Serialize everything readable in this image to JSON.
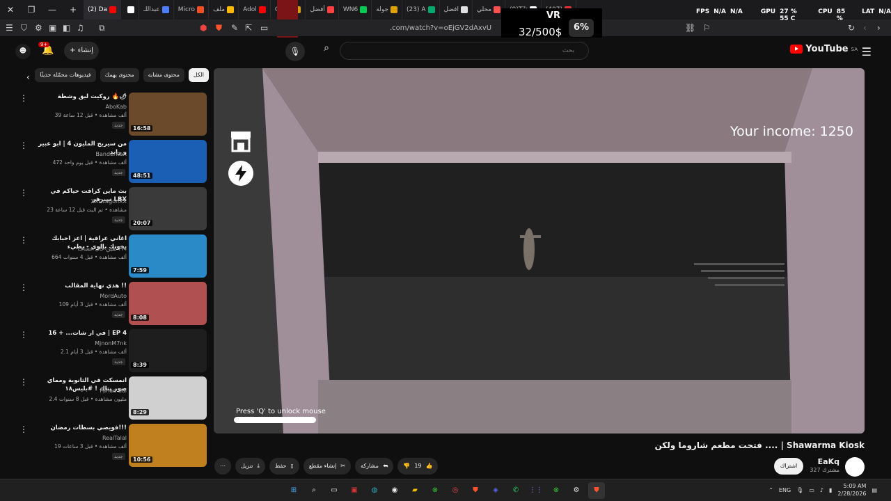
{
  "browser": {
    "tabs": [
      {
        "label": "(2) Da",
        "color": "#ff0000",
        "active": true
      },
      {
        "label": "",
        "color": "#ffffff"
      },
      {
        "label": "عبداللـ",
        "color": "#4c7dff"
      },
      {
        "label": "Micro",
        "color": "#f25022"
      },
      {
        "label": "ملف",
        "color": "#ffb900"
      },
      {
        "label": "Adol",
        "color": "#ff0000"
      },
      {
        "label": "Chick",
        "color": "#d4a017"
      },
      {
        "label": "أفضل",
        "color": "#ff4040"
      },
      {
        "label": "WN6",
        "color": "#00c853"
      },
      {
        "label": "جولة",
        "color": "#e0a000"
      },
      {
        "label": "(23) A",
        "color": "#00a86b"
      },
      {
        "label": "افضل",
        "color": "#e0e0e0"
      },
      {
        "label": "محلي",
        "color": "#ff5050"
      },
      {
        "label": "(9)Tik",
        "color": "#ffffff"
      },
      {
        "label": "(407)",
        "color": "#e03030"
      }
    ],
    "url": ".com/watch?v=oEjGV2dAxvU"
  },
  "overlay": {
    "vr_label": "VR",
    "money": "32/500$",
    "percent": "6%",
    "hw": {
      "fps_label": "FPS",
      "fps_value": "N/A",
      "na2": "N/A",
      "gpu_label": "GPU",
      "gpu_value": "27 % 55 C",
      "cpu_label": "CPU",
      "cpu_value": "85 %",
      "lat_label": "LAT",
      "lat_value": "N/A"
    }
  },
  "youtube": {
    "logo_text": "YouTube",
    "logo_region": "SA",
    "search_placeholder": "بحث",
    "create_label": "إنشاء",
    "notif_count": "9+"
  },
  "chips": [
    "الكل",
    "محتوى مشابه",
    "محتوى يهمك",
    "فيديوهات محمّلة حديثًا"
  ],
  "recommendations": [
    {
      "title": "روكيت ليق وشطة 🔥🌶",
      "channel": "AboKab",
      "meta": "39 ألف مشاهدة • قبل 12 ساعة",
      "badge": "جديد",
      "duration": "16:58",
      "thumb": "#6a4a2a"
    },
    {
      "title": "من سيربح المليون 4 | ابو عبير و رايد",
      "channel": "BanderitaX",
      "meta": "472 ألف مشاهدة • قبل يوم واحد",
      "badge": "جديد",
      "duration": "48:51",
      "thumb": "#1a5fb4"
    },
    {
      "title": "بث ماين كرافت حياكم في سيرفر LBX",
      "channel": "XXDragonXX",
      "meta": "23 مشاهدة • تم البث قبل 12 ساعة",
      "badge": "جديد",
      "duration": "20:07",
      "thumb": "#3a3a3a"
    },
    {
      "title": "اغاني عراقية | اعز احبابك بخونك بالوي - بطيء",
      "channel": "لمين حال عشاف FM",
      "meta": "664 ألف مشاهدة • قبل 4 سنوات",
      "badge": "",
      "duration": "7:59",
      "thumb": "#2a8ac8"
    },
    {
      "title": "هذي نهاية المقالب !!",
      "channel": "MordAuto",
      "meta": "109 ألف مشاهدة • قبل 3 أيام",
      "badge": "جديد",
      "duration": "8:08",
      "thumb": "#b05050"
    },
    {
      "title": "في ار شات... + 16 | EP 4",
      "channel": "MjnonM7nk",
      "meta": "2.1 ألف مشاهدة • قبل 3 أيام",
      "badge": "جديد",
      "duration": "8:39",
      "thumb": "#1e1e1e"
    },
    {
      "title": "انمسكت في الثانوية ومماي صور بتاك ! #بليس١٨",
      "channel": "Fahad Sal",
      "meta": "2.4 مليون مشاهدة • قبل 8 سنوات",
      "badge": "",
      "duration": "8:29",
      "thumb": "#d0d0d0"
    },
    {
      "title": "فويصي بسطات رمضان!!!",
      "channel": "RealTalal",
      "meta": "19 ألف مشاهدة • قبل 3 ساعات",
      "badge": "جديد",
      "duration": "10:56",
      "thumb": "#c08020"
    }
  ],
  "game": {
    "income": "Your income: 1250",
    "unlock_hint": "Press 'Q' to unlock mouse"
  },
  "video": {
    "title": "فتحت مطعم شاروما ولكن .... | Shawarma Kiosk",
    "channel": "EaKq",
    "subs": "327 مشترك",
    "subscribe_label": "اشتراك",
    "likes": "19",
    "share_label": "مشاركة",
    "clip_label": "إنشاء مقطع",
    "save_label": "حفظ",
    "download_label": "تنزيل"
  },
  "taskbar": {
    "lang": "ENG",
    "time": "5:09 AM",
    "date": "2/28/2026"
  }
}
